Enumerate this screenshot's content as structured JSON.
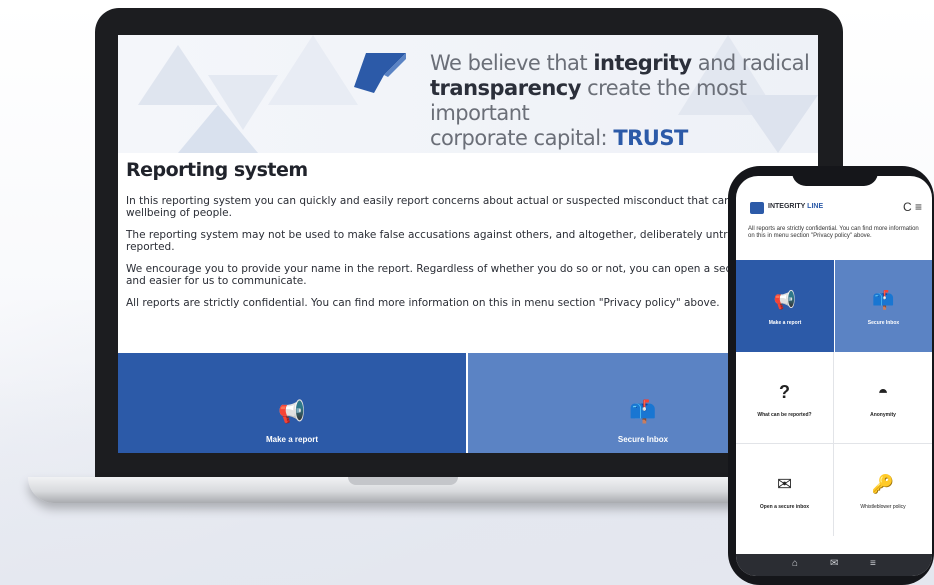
{
  "banner": {
    "tagline_part1": "We believe that ",
    "tagline_bold1": "integrity",
    "tagline_part2": " and radical",
    "tagline_bold2": "transparency",
    "tagline_part3": " create the most important",
    "tagline_part4": "corporate capital: ",
    "tagline_trust": "TRUST"
  },
  "desktop": {
    "heading": "Reporting system",
    "paragraphs": [
      "In this reporting system you can quickly and easily report concerns about actual or suspected misconduct that can affect the wellbeing of people.",
      "The reporting system may not be used to make false accusations against others, and altogether, deliberately untrue infor be reported.",
      "We encourage you to provide your name in the report. Regardless of whether you do so or not, you can open a secure Inb it safer and easier for us to communicate.",
      "All reports are strictly confidential. You can find more information on this in menu section \"Privacy policy\" above."
    ],
    "tiles": [
      {
        "label": "Make a report",
        "icon": "megaphone-icon",
        "glyph": "📢"
      },
      {
        "label": "Secure Inbox",
        "icon": "mailbox-icon",
        "glyph": "📫"
      }
    ]
  },
  "phone": {
    "brand_a": "INTEGRITY",
    "brand_b": "LINE",
    "header_icons": "C ≡",
    "note": "All reports are strictly confidential. You can find more information on this in menu section \"Privacy policy\" above.",
    "tiles": [
      {
        "label": "Make a report",
        "icon": "megaphone-icon",
        "glyph": "📢"
      },
      {
        "label": "Secure Inbox",
        "icon": "mailbox-icon",
        "glyph": "📫"
      },
      {
        "label": "What can be reported?",
        "icon": "question-icon",
        "glyph": "?"
      },
      {
        "label": "Anonymity",
        "icon": "mask-icon",
        "glyph": "◓"
      },
      {
        "label": "Open a secure inbox",
        "icon": "envelope-icon",
        "glyph": "✉"
      },
      {
        "label": "Whistleblower policy",
        "icon": "key-icon",
        "glyph": "🔑"
      }
    ],
    "nav": [
      "⌂",
      "✉",
      "≡"
    ]
  },
  "colors": {
    "accent": "#2c5aa8",
    "tile_light": "#5b83c4",
    "laptop_bezel": "#1c1d20"
  }
}
